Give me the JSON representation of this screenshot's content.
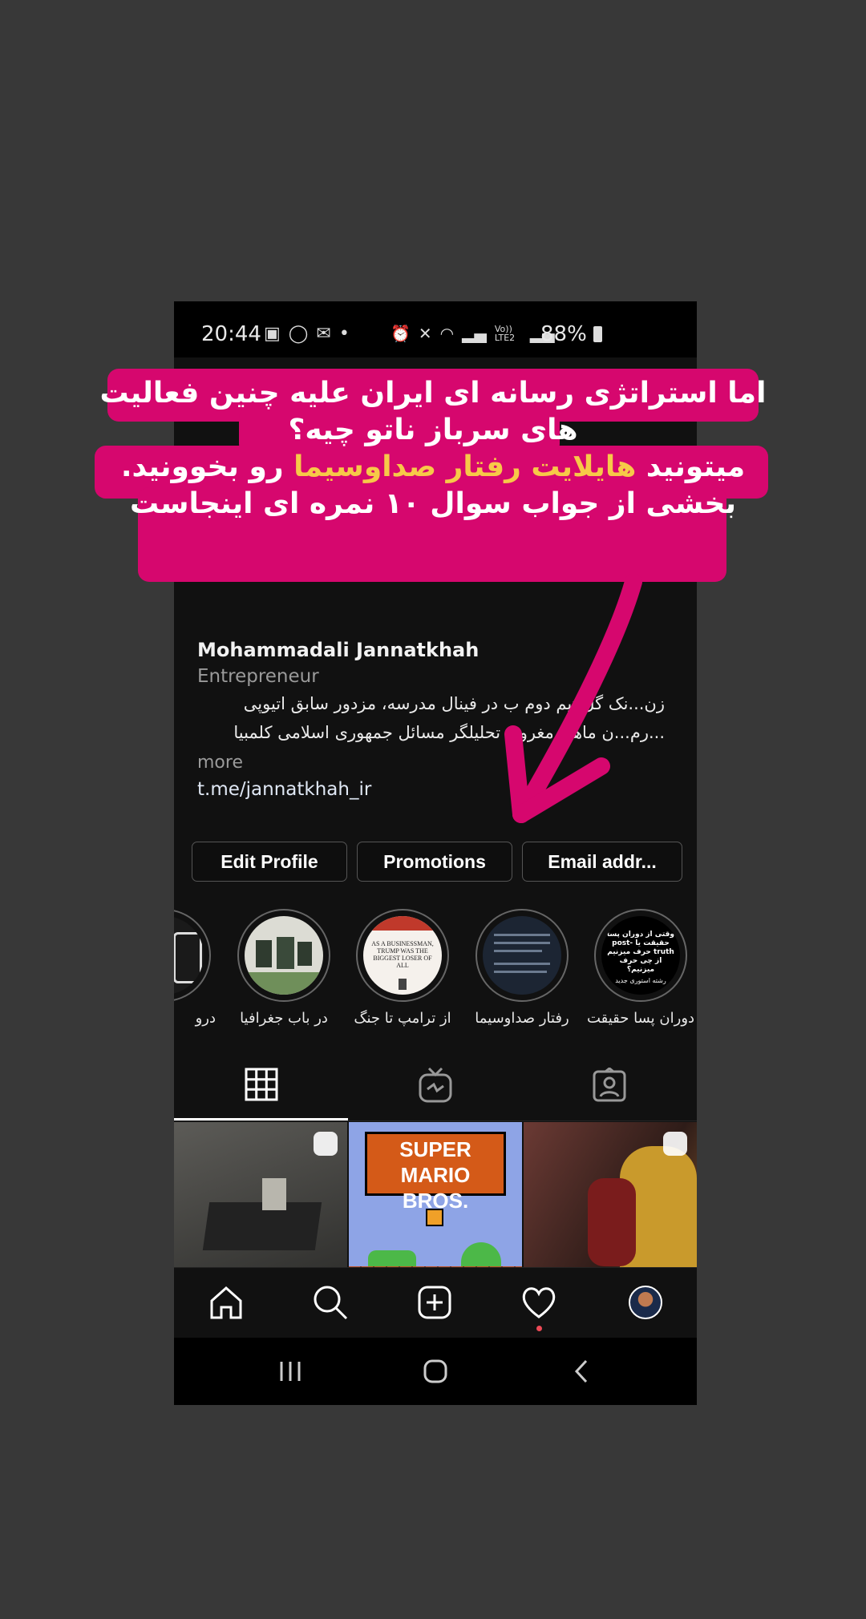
{
  "status_bar": {
    "time": "20:44",
    "battery": "88%",
    "network": "Vo)) LTE2"
  },
  "overlay": {
    "line1": "اما استراتژی رسانه ای ایران علیه چنین فعالیت",
    "line2": "های سرباز ناتو چیه؟",
    "line3_pre": "میتونید ",
    "line3_highlight": "هایلایت رفتار صداوسیما",
    "line3_post": " رو بخوونید.",
    "line4": "بخشی از جواب سوال ۱۰ نمره ای اینجاست",
    "box_color": "#d6076e",
    "highlight_color": "#f7c948"
  },
  "profile": {
    "name": "Mohammadali Jannatkhah",
    "category": "Entrepreneur",
    "bio_line1": "زن...نک گل تیم دوم ب در فینال مدرسه، مزدور سابق اتیوپی",
    "bio_line2": "...رم...ن ماهی مغرور، تحلیلگر مسائل جمهوری اسلامی کلمبیا",
    "more": "more",
    "link": "t.me/jannatkhah_ir"
  },
  "buttons": {
    "edit_profile": "Edit Profile",
    "promotions": "Promotions",
    "email": "Email addr..."
  },
  "highlights": [
    {
      "label": "دوران پسا حقیقت",
      "cover_text": "وقتی از دوران پسا حقیقت یا post-truth حرف میزنیم از چی حرف میزنیم؟",
      "cover_footer": "رشته استوری جدید"
    },
    {
      "label": "رفتار صداوسیما"
    },
    {
      "label": "از ترامپ تا جنگ",
      "cover_text": "AS A BUSINESSMAN, TRUMP WAS THE BIGGEST LOSER OF ALL"
    },
    {
      "label": "در باب جغرافیا"
    },
    {
      "label": "درو"
    }
  ],
  "grid_posts": [
    {
      "label": ""
    },
    {
      "label": "SUPER MARIO BROS."
    },
    {
      "label": ""
    }
  ]
}
